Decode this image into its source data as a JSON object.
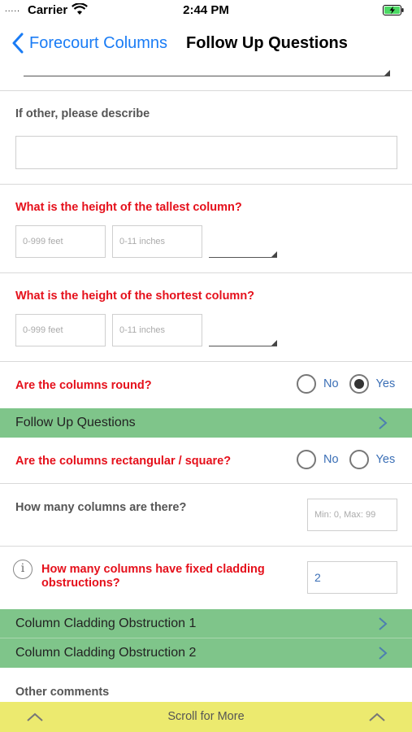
{
  "status": {
    "dots": ".....",
    "carrier": "Carrier",
    "time": "2:44 PM"
  },
  "nav": {
    "back_label": "Forecourt Columns",
    "title": "Follow Up Questions"
  },
  "other": {
    "label": "If other, please describe",
    "value": ""
  },
  "tallest": {
    "label": "What is the height of the tallest column?",
    "feet_placeholder": "0-999 feet",
    "inches_placeholder": "0-11 inches"
  },
  "shortest": {
    "label": "What is the height of the shortest column?",
    "feet_placeholder": "0-999 feet",
    "inches_placeholder": "0-11 inches"
  },
  "round": {
    "label": "Are the columns round?",
    "no": "No",
    "yes": "Yes",
    "selected": "Yes"
  },
  "follow_up": {
    "label": "Follow Up Questions"
  },
  "rectangular": {
    "label": "Are the columns rectangular / square?",
    "no": "No",
    "yes": "Yes",
    "selected": ""
  },
  "count": {
    "label": "How many columns are there?",
    "placeholder": "Min: 0, Max: 99"
  },
  "cladding": {
    "label": "How many columns have fixed cladding obstructions?",
    "value": "2"
  },
  "obstructions": [
    {
      "label": "Column Cladding Obstruction 1"
    },
    {
      "label": "Column Cladding Obstruction 2"
    }
  ],
  "comments": {
    "label": "Other comments"
  },
  "bottom": {
    "label": "Scroll for More"
  },
  "colors": {
    "accent": "#1a7cf5",
    "required": "#e5101b",
    "section_green": "#7fc58a",
    "scroll_bar": "#ecea6f"
  }
}
